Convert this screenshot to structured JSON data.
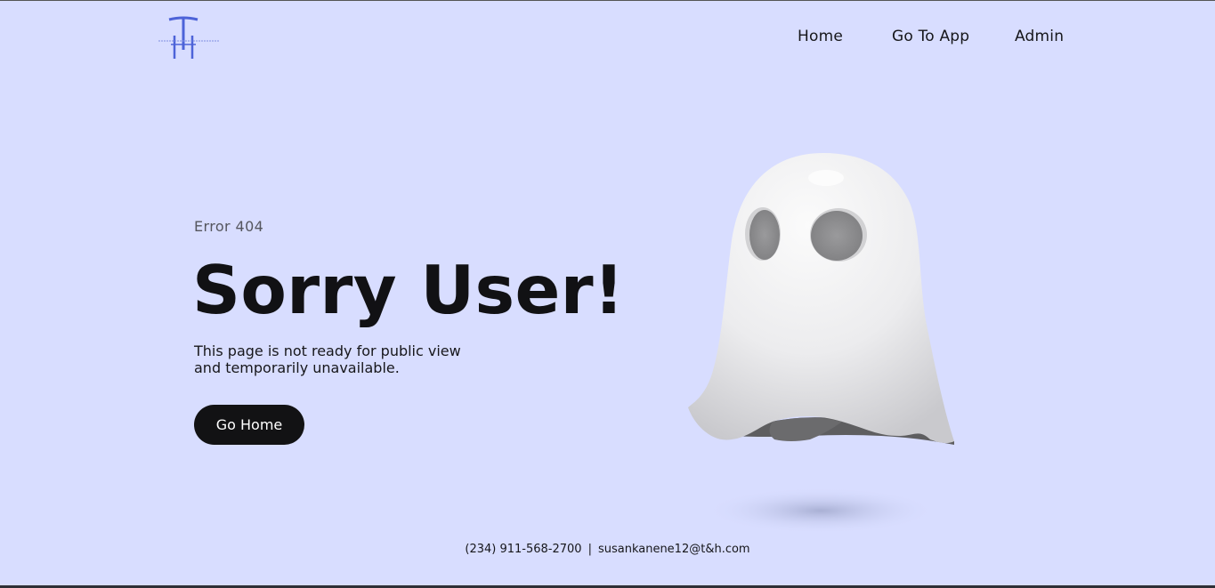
{
  "header": {
    "logo_name": "tri-letter-logo",
    "nav": [
      {
        "label": "Home"
      },
      {
        "label": "Go To App"
      },
      {
        "label": "Admin"
      }
    ]
  },
  "main": {
    "eyebrow": "Error 404",
    "headline": "Sorry User!",
    "description_line1": "This page is not ready for public view",
    "description_line2": "and temporarily unavailable.",
    "button_label": "Go Home",
    "illustration": "ghost-illustration"
  },
  "footer": {
    "phone": "(234) 911-568-2700",
    "separator": "|",
    "email": "susankanene12@t&h.com"
  },
  "colors": {
    "background": "#d8ddff",
    "logo_blue": "#4d63d8",
    "button_bg": "#121214",
    "button_text": "#ffffff",
    "text_dark": "#111114"
  }
}
